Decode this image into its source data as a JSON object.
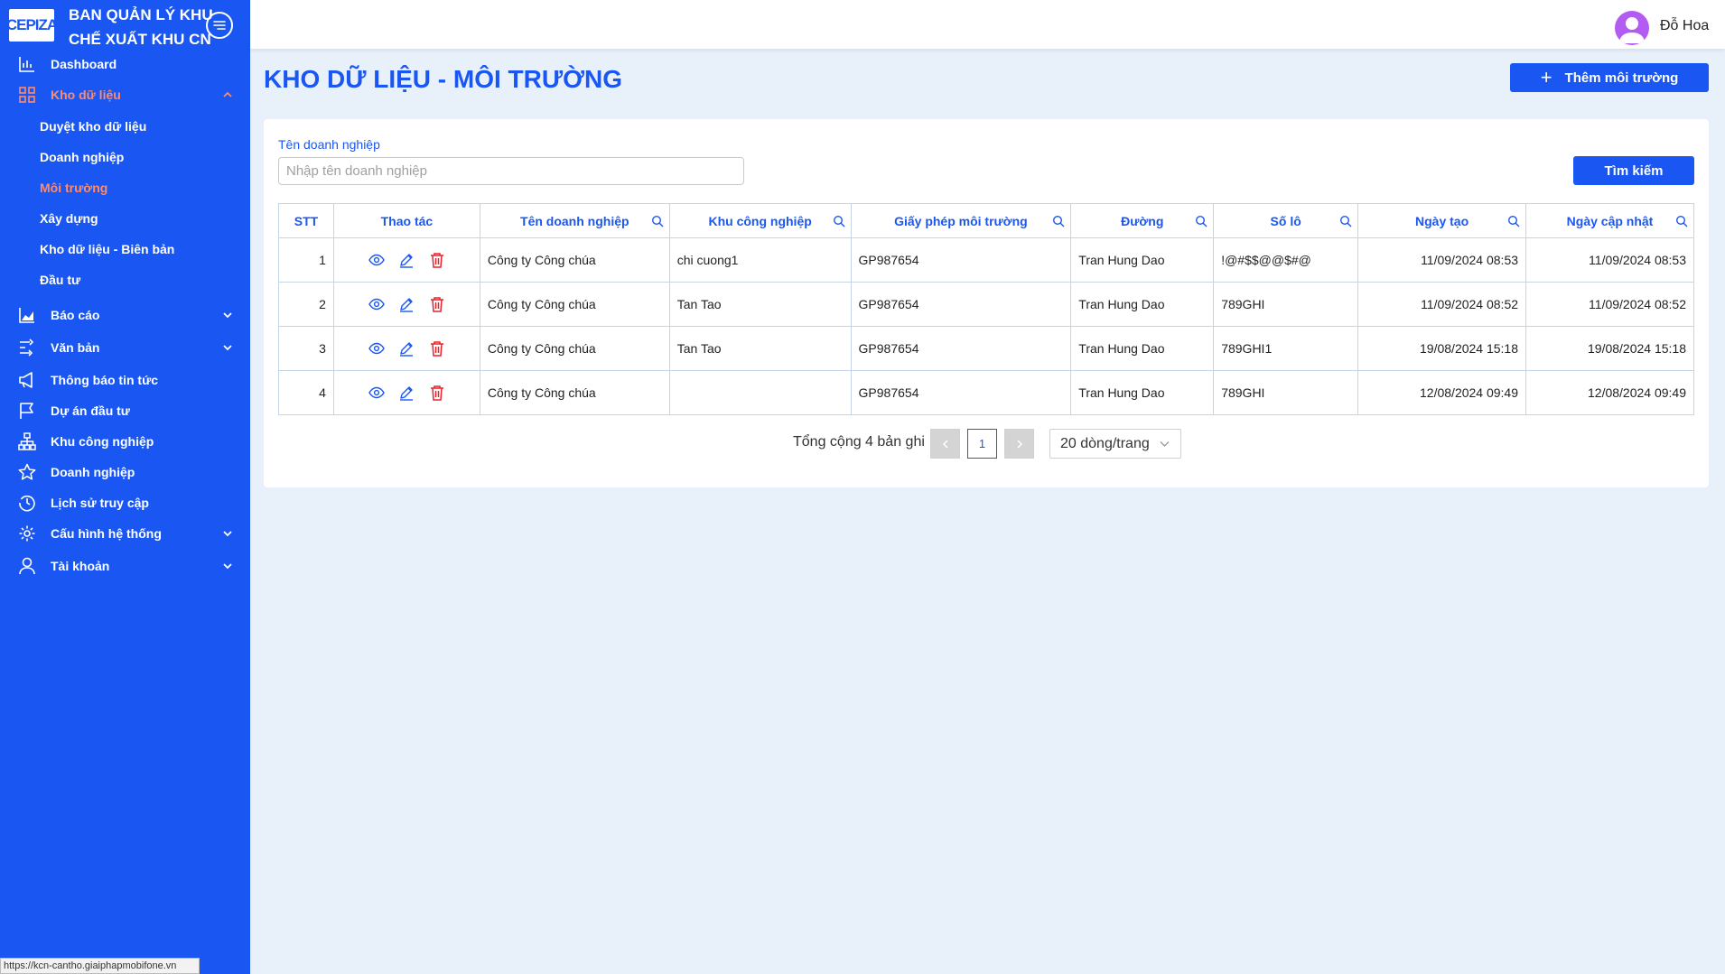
{
  "brand": {
    "logo_text": "CEPIZA",
    "org_name": "BAN QUẢN LÝ KHU CHẾ XUẤT KHU CN"
  },
  "sidebar": {
    "items": [
      {
        "label": "Dashboard"
      },
      {
        "label": "Kho dữ liệu"
      },
      {
        "label": "Báo cáo"
      },
      {
        "label": "Văn bản"
      },
      {
        "label": "Thông báo tin tức"
      },
      {
        "label": "Dự án đầu tư"
      },
      {
        "label": "Khu công nghiệp"
      },
      {
        "label": "Doanh nghiệp"
      },
      {
        "label": "Lịch sử truy cập"
      },
      {
        "label": "Cấu hình hệ thống"
      },
      {
        "label": "Tài khoản"
      }
    ],
    "sub_items": [
      {
        "label": "Duyệt kho dữ liệu"
      },
      {
        "label": "Doanh nghiệp"
      },
      {
        "label": "Môi trường"
      },
      {
        "label": "Xây dựng"
      },
      {
        "label": "Kho dữ liệu - Biên bản"
      },
      {
        "label": "Đầu tư"
      }
    ],
    "active_color": "#ff8b6a",
    "background": "#1a57f2"
  },
  "header": {
    "user_name": "Đỗ Hoa"
  },
  "page": {
    "title": "KHO DỮ LIỆU - MÔI TRƯỜNG",
    "add_button": "Thêm môi trường",
    "search_label": "Tên doanh nghiệp",
    "search_placeholder": "Nhập tên doanh nghiệp",
    "search_value": "",
    "search_button": "Tìm kiếm"
  },
  "table": {
    "columns": [
      "STT",
      "Thao tác",
      "Tên doanh nghiệp",
      "Khu công nghiệp",
      "Giấy phép môi trường",
      "Đường",
      "Số lô",
      "Ngày tạo",
      "Ngày cập nhật"
    ],
    "rows": [
      {
        "stt": "1",
        "ten_dn": "Công ty Công chúa",
        "khu_cn": "chi cuong1",
        "giay_phep": "GP987654",
        "duong": "Tran Hung Dao",
        "so_lo": "!@#$$@@$#@",
        "ngay_tao": "11/09/2024 08:53",
        "ngay_cap_nhat": "11/09/2024 08:53"
      },
      {
        "stt": "2",
        "ten_dn": "Công ty Công chúa",
        "khu_cn": "Tan Tao",
        "giay_phep": "GP987654",
        "duong": "Tran Hung Dao",
        "so_lo": "789GHI",
        "ngay_tao": "11/09/2024 08:52",
        "ngay_cap_nhat": "11/09/2024 08:52"
      },
      {
        "stt": "3",
        "ten_dn": "Công ty Công chúa",
        "khu_cn": "Tan Tao",
        "giay_phep": "GP987654",
        "duong": "Tran Hung Dao",
        "so_lo": "789GHI1",
        "ngay_tao": "19/08/2024 15:18",
        "ngay_cap_nhat": "19/08/2024 15:18"
      },
      {
        "stt": "4",
        "ten_dn": "Công ty Công chúa",
        "khu_cn": "",
        "giay_phep": "GP987654",
        "duong": "Tran Hung Dao",
        "so_lo": "789GHI",
        "ngay_tao": "12/08/2024 09:49",
        "ngay_cap_nhat": "12/08/2024 09:49"
      }
    ]
  },
  "pagination": {
    "total_text": "Tổng cộng 4 bản ghi",
    "current_page": "1",
    "page_size": "20 dòng/trang"
  },
  "statusbar": {
    "url": "https://kcn-cantho.giaiphapmobifone.vn"
  },
  "icons": {
    "view": "eye-icon",
    "edit": "pencil-icon",
    "delete": "trash-icon",
    "colors": {
      "view": "#1a57f2",
      "edit": "#1a57f2",
      "delete": "#e8212b"
    }
  }
}
